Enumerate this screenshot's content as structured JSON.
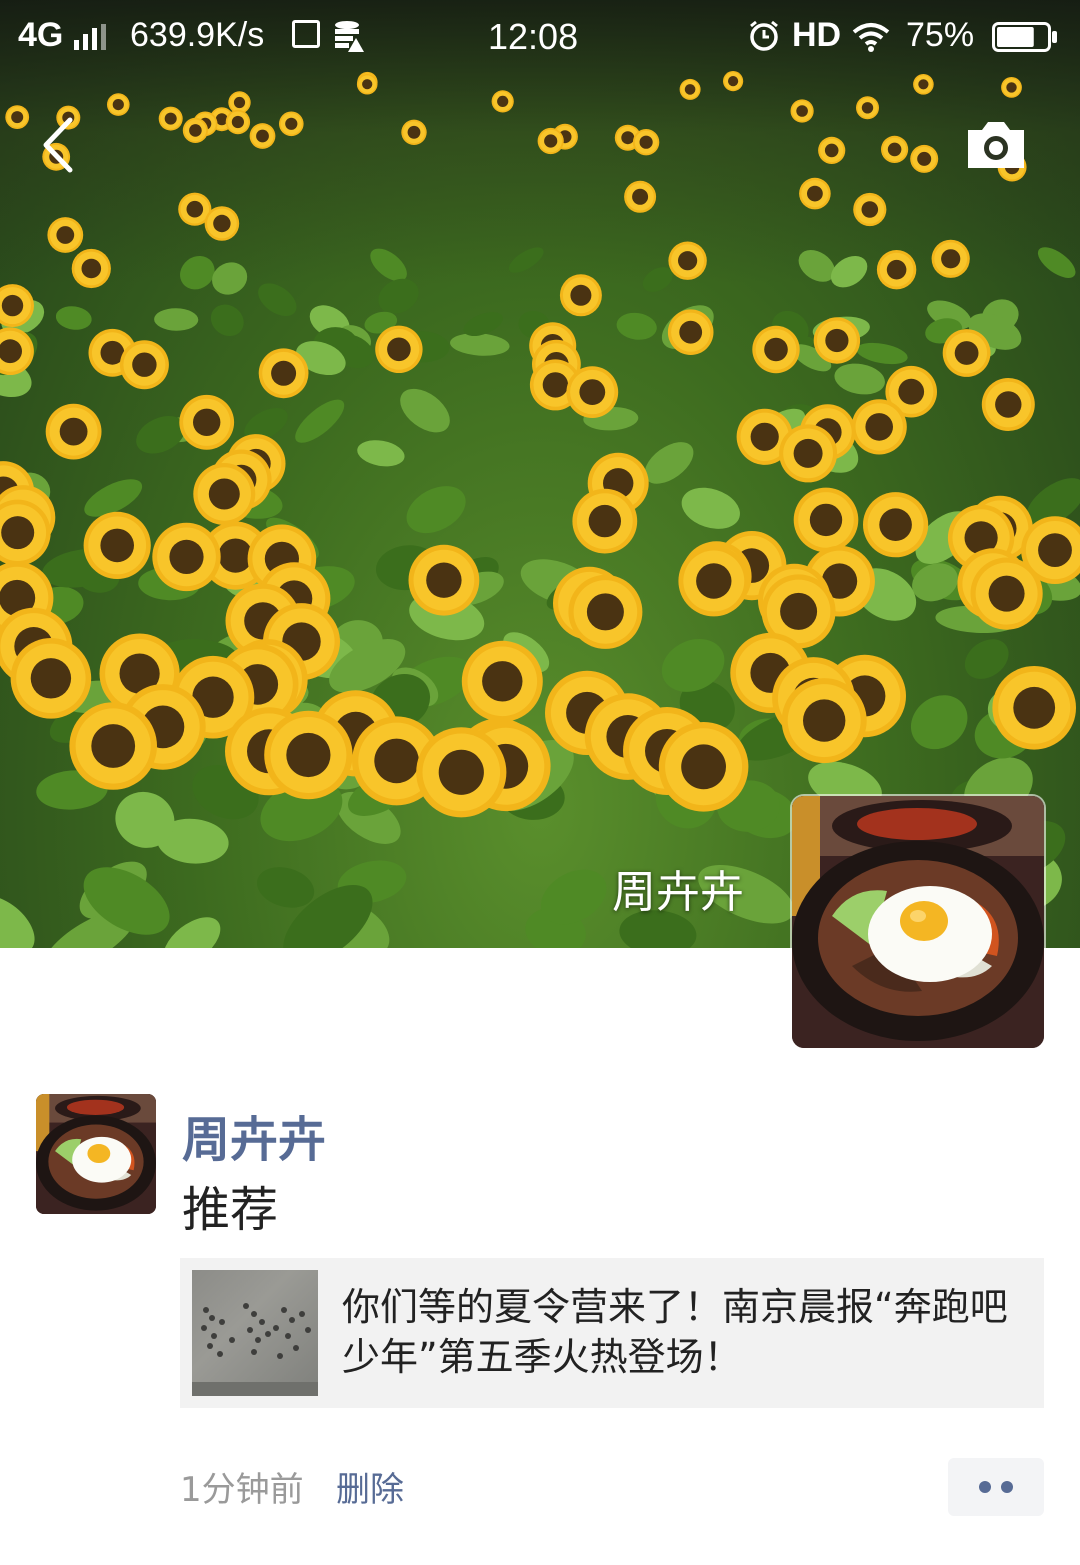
{
  "status_bar": {
    "network": "4G",
    "speed": "639.9K/s",
    "time": "12:08",
    "hd": "HD",
    "battery_percent": "75%",
    "battery_level": 0.75
  },
  "nav": {
    "back_icon": "chevron-left-icon",
    "camera_icon": "camera-icon"
  },
  "profile": {
    "display_name": "周卉卉"
  },
  "post": {
    "author": "周卉卉",
    "text": "推荐",
    "shared_link": {
      "title": "你们等的夏令营来了！南京晨报“奔跑吧少年”第五季火热登场！"
    },
    "time_ago": "1分钟前",
    "delete_label": "删除"
  },
  "colors": {
    "link_blue": "#576b95",
    "card_background": "#f2f2f2",
    "meta_gray": "#9a9a9a"
  }
}
